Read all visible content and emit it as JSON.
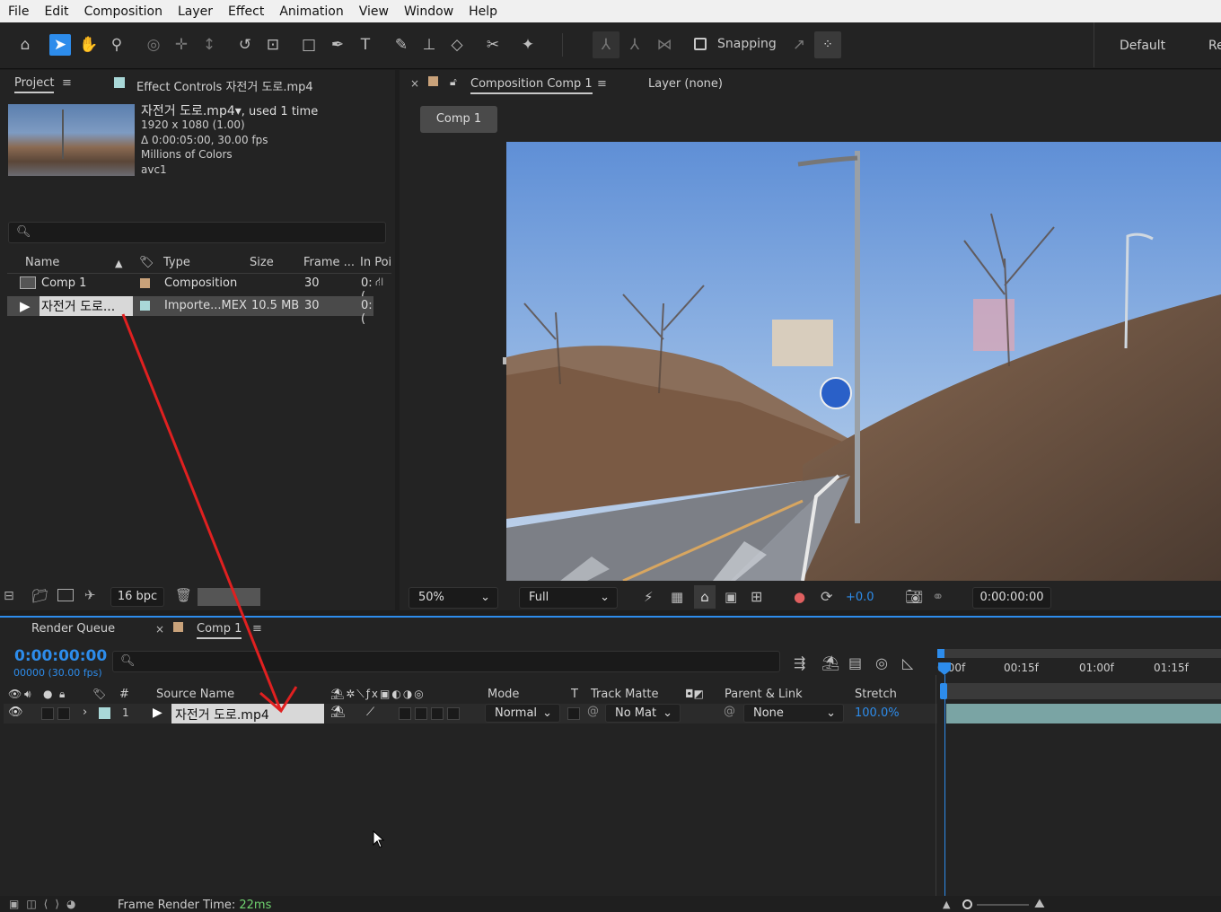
{
  "menu": [
    "File",
    "Edit",
    "Composition",
    "Layer",
    "Effect",
    "Animation",
    "View",
    "Window",
    "Help"
  ],
  "toolbar": {
    "snapping_label": "Snapping",
    "workspace": "Default",
    "workspace_next": "Re"
  },
  "project": {
    "tab_label": "Project",
    "effect_controls_label": "Effect Controls 자전거 도로.mp4",
    "footage_name": "자전거 도로.mp4",
    "used_text": ", used 1 time",
    "resolution": "1920 x 1080 (1.00)",
    "duration": "Δ 0:00:05:00, 30.00 fps",
    "colors": "Millions of Colors",
    "codec": "avc1",
    "columns": {
      "name": "Name",
      "type": "Type",
      "size": "Size",
      "frame": "Frame ...",
      "in_point": "In Poi"
    },
    "items": [
      {
        "name": "Comp 1",
        "type": "Composition",
        "size": "",
        "frame": "30",
        "in_point": "0:(",
        "label_color": "#c9a27a"
      },
      {
        "name": "자전거 도로...",
        "type": "Importe...MEX",
        "size": "10.5 MB",
        "frame": "30",
        "in_point": "0:(",
        "label_color": "#a9d8d8"
      }
    ],
    "bpc": "16 bpc"
  },
  "viewer": {
    "comp_tab_label": "Composition Comp 1",
    "layer_tab_label": "Layer (none)",
    "comp_button": "Comp 1",
    "zoom": "50%",
    "resolution": "Full",
    "exposure": "+0.0",
    "timecode": "0:00:00:00"
  },
  "timeline": {
    "render_queue_tab": "Render Queue",
    "comp_tab": "Comp 1",
    "current_time": "0:00:00:00",
    "frame_info": "00000 (30.00 fps)",
    "ruler": [
      "0:00f",
      "00:15f",
      "01:00f",
      "01:15f"
    ],
    "columns": {
      "num": "#",
      "source_name": "Source Name",
      "mode": "Mode",
      "t": "T",
      "track_matte": "Track Matte",
      "parent": "Parent & Link",
      "stretch": "Stretch"
    },
    "layers": [
      {
        "index": "1",
        "source_name": "자전거 도로.mp4",
        "mode": "Normal",
        "track_matte": "No Mat",
        "parent": "None",
        "stretch": "100.0%",
        "label_color": "#a9d8d8"
      }
    ]
  },
  "status": {
    "frame_render_label": "Frame Render Time:",
    "frame_render_value": "22ms"
  },
  "colors": {
    "accent": "#2d8ceb",
    "annotation_arrow": "#e02020"
  }
}
